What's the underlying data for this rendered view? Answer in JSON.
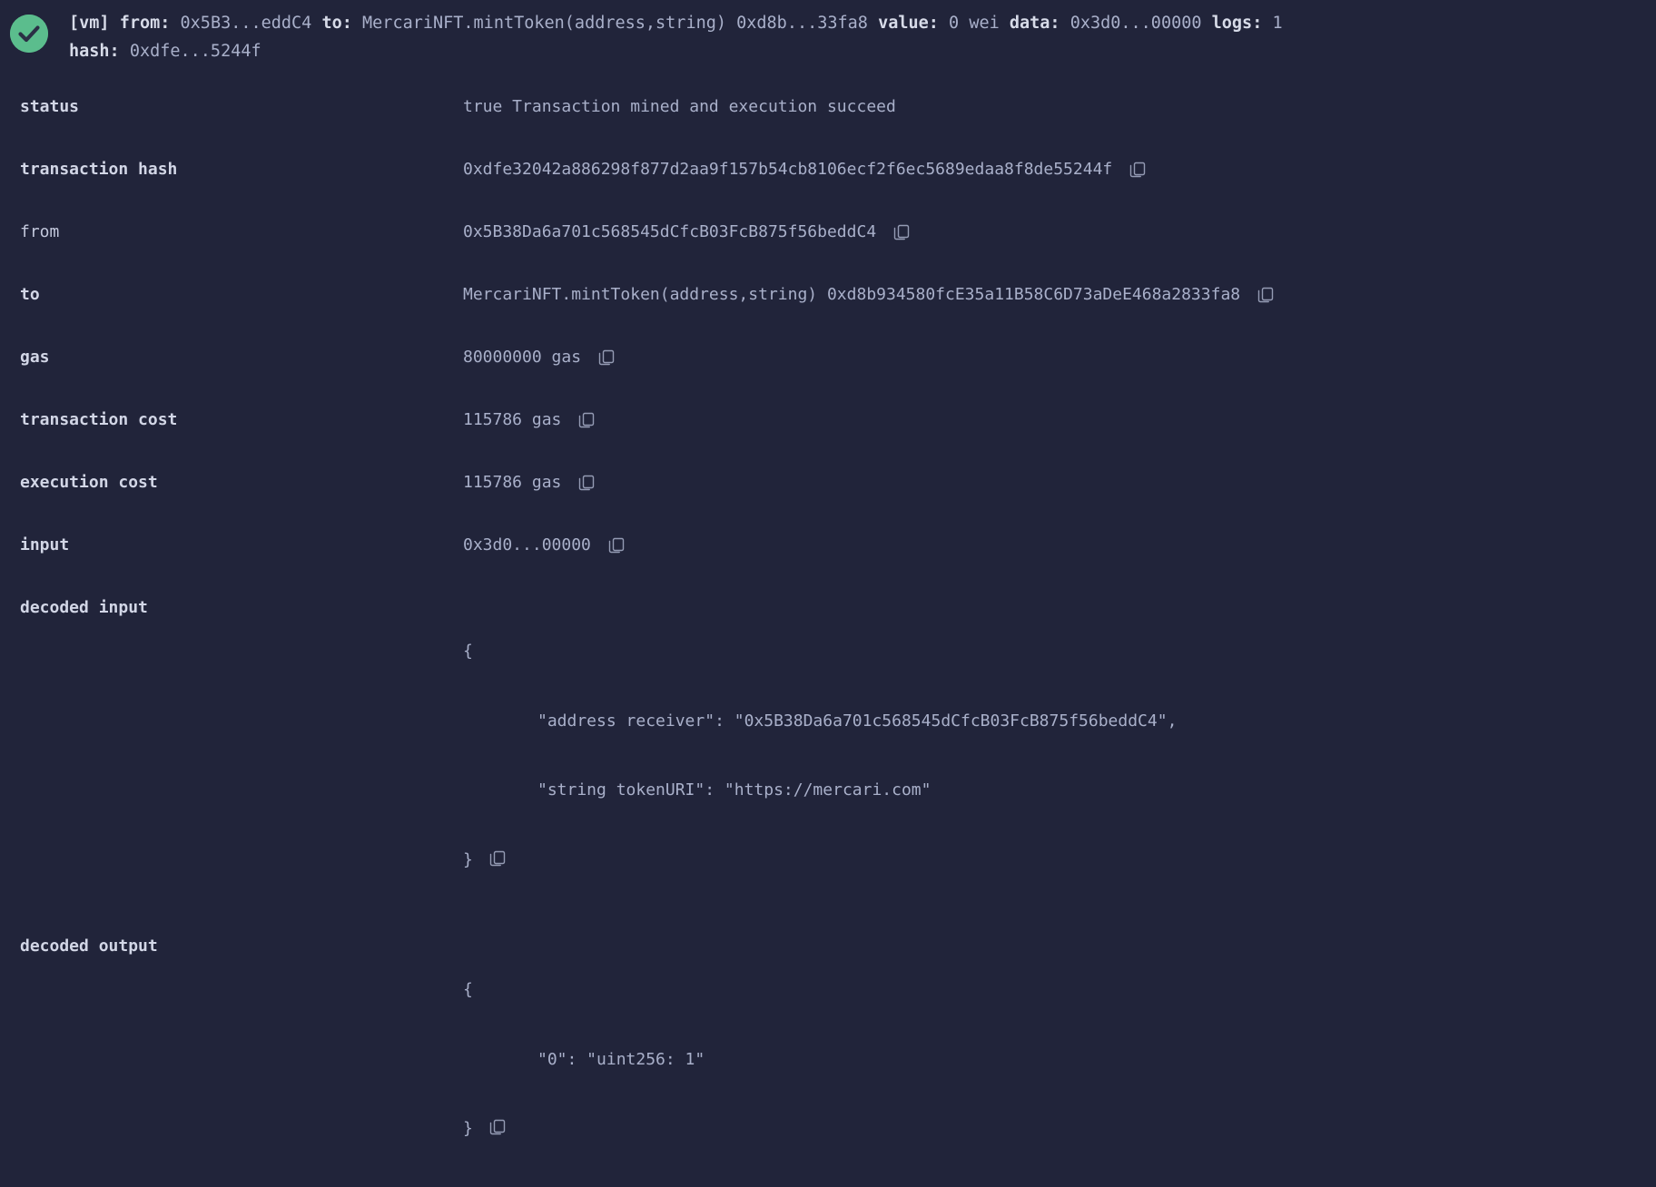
{
  "header": {
    "status_icon": "check-circle-icon",
    "line1_parts": [
      {
        "text": "[vm] ",
        "bold": true
      },
      {
        "text": "from: ",
        "bold": true
      },
      {
        "text": "0x5B3...eddC4 ",
        "bold": false
      },
      {
        "text": "to: ",
        "bold": true
      },
      {
        "text": "MercariNFT.mintToken(address,string) 0xd8b...33fa8 ",
        "bold": false
      },
      {
        "text": "value: ",
        "bold": true
      },
      {
        "text": "0 wei ",
        "bold": false
      },
      {
        "text": "data: ",
        "bold": true
      },
      {
        "text": "0x3d0...00000 ",
        "bold": false
      },
      {
        "text": "logs: ",
        "bold": true
      },
      {
        "text": "1",
        "bold": false
      }
    ],
    "line2_parts": [
      {
        "text": "hash: ",
        "bold": true
      },
      {
        "text": "0xdfe...5244f",
        "bold": false
      }
    ]
  },
  "rows": [
    {
      "label": "status",
      "label_bold": true,
      "value": "true Transaction mined and execution succeed",
      "copy": false
    },
    {
      "label": "transaction hash",
      "label_bold": true,
      "value": "0xdfe32042a886298f877d2aa9f157b54cb8106ecf2f6ec5689edaa8f8de55244f",
      "copy": true
    },
    {
      "label": "from",
      "label_bold": false,
      "value": "0x5B38Da6a701c568545dCfcB03FcB875f56beddC4",
      "copy": true
    },
    {
      "label": "to",
      "label_bold": true,
      "value": "MercariNFT.mintToken(address,string) 0xd8b934580fcE35a11B58C6D73aDeE468a2833fa8",
      "copy": true
    },
    {
      "label": "gas",
      "label_bold": true,
      "value": "80000000 gas",
      "copy": true
    },
    {
      "label": "transaction cost",
      "label_bold": true,
      "value": "115786 gas",
      "copy": true
    },
    {
      "label": "execution cost",
      "label_bold": true,
      "value": "115786 gas",
      "copy": true
    },
    {
      "label": "input",
      "label_bold": true,
      "value": "0x3d0...00000",
      "copy": true
    }
  ],
  "decoded_input": {
    "label": "decoded input",
    "open_brace": "{",
    "lines": [
      "\"address receiver\": \"0x5B38Da6a701c568545dCfcB03FcB875f56beddC4\",",
      "\"string tokenURI\": \"https://mercari.com\""
    ],
    "close_brace": "}",
    "copy": true
  },
  "decoded_output": {
    "label": "decoded output",
    "open_brace": "{",
    "lines": [
      "\"0\": \"uint256: 1\""
    ],
    "close_brace": "}",
    "copy": true
  },
  "colors": {
    "background": "#21243a",
    "success": "#5bbd8d",
    "text": "#a9b0ca",
    "label": "#d2d6e6"
  },
  "icons": {
    "copy": "copy-icon",
    "check": "check-circle-icon"
  }
}
